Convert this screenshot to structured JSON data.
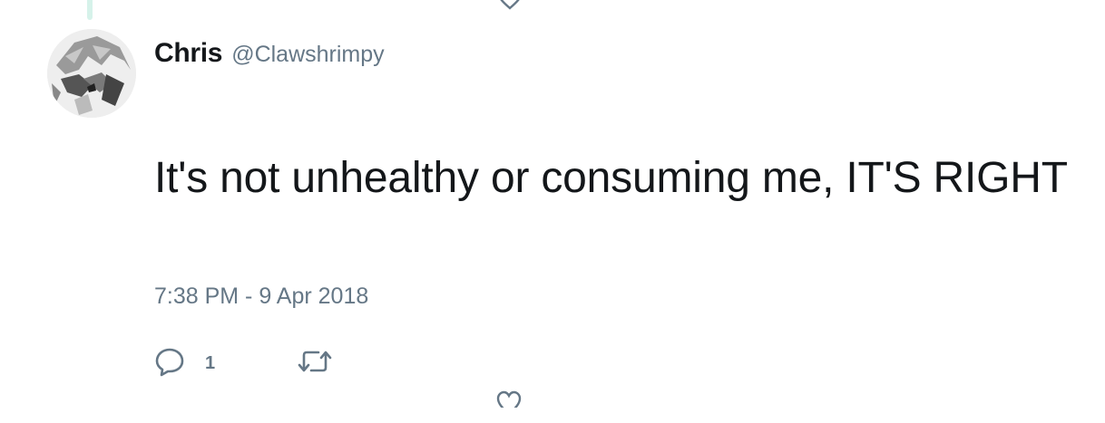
{
  "tweet": {
    "display_name": "Chris",
    "handle": "@Clawshrimpy",
    "text": "It's not unhealthy or consuming me, IT'S RIGHT",
    "timestamp": "7:38 PM - 9 Apr 2018",
    "reply_count": "1"
  },
  "icons": {
    "reply": "reply-icon",
    "retweet": "retweet-icon",
    "like": "heart-icon",
    "avatar": "avatar-image"
  },
  "colors": {
    "text": "#14171a",
    "secondary": "#657786",
    "thread_line": "#d6f2ea"
  }
}
